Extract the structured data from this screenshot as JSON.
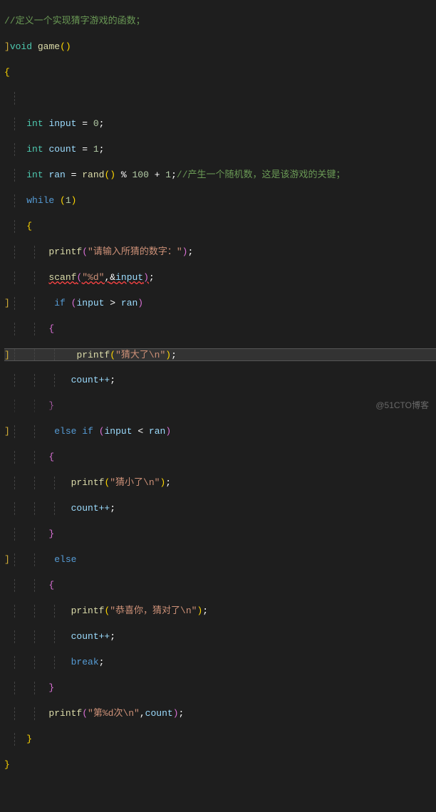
{
  "code": {
    "comment_top": "//定义一个实现猜字游戏的函数；",
    "sig_void": "void",
    "sig_name": "game",
    "sig_parens": "()",
    "brace_open": "{",
    "brace_close": "}",
    "decl_int": "int",
    "decl_input": "input",
    "decl_count": "count",
    "decl_ran": "ran",
    "eq": " = ",
    "zero": "0",
    "one_a": "1",
    "one_b": "1",
    "one_c": "1",
    "semi": ";",
    "rand_name": "rand",
    "rand_parens": "()",
    "mod": " % ",
    "hundred": "100",
    "plus": " + ",
    "comment_rand": "//产生一个随机数，这是该游戏的关键；",
    "while_kw": "while",
    "space": " ",
    "paren_l": "(",
    "paren_r": ")",
    "printf_name": "printf",
    "str_prompt": "\"请输入所猜的数字：\"",
    "scanf_name": "scanf",
    "str_fmt": "\"%d\"",
    "comma": ",",
    "amp": "&",
    "if_kw": "if",
    "gt": " > ",
    "lt": " < ",
    "str_big": "\"猜大了\\n\"",
    "countpp": "count++",
    "else_kw": "else",
    "str_small": "\"猜小了\\n\"",
    "str_congrats": "\"恭喜你，猜对了\\n\"",
    "break_kw": "break",
    "str_times": "\"第%d次\\n\"",
    "comment_bottom": "//产生一个随机数…"
  },
  "watermark": "@51CTO博客"
}
